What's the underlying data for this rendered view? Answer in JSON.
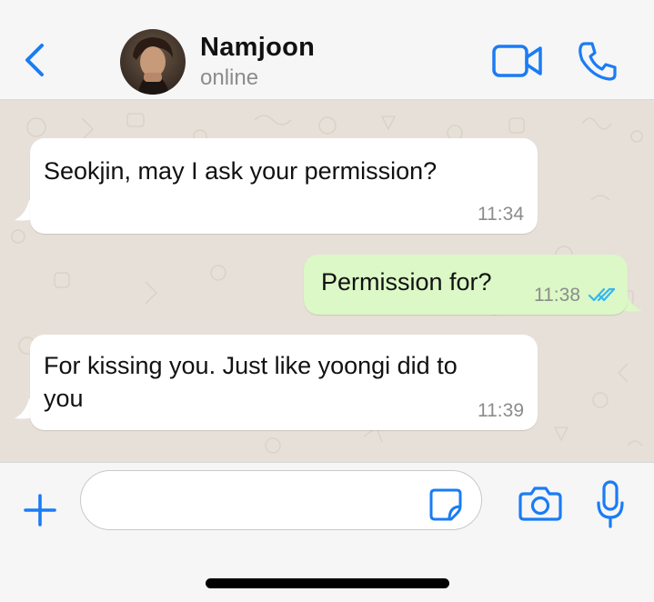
{
  "header": {
    "back_icon": "chevron-left-icon",
    "contact_name": "Namjoon",
    "contact_status": "online",
    "video_icon": "video-camera-icon",
    "call_icon": "phone-icon"
  },
  "messages": [
    {
      "direction": "incoming",
      "text": "Seokjin, may I ask your permission?",
      "time": "11:34"
    },
    {
      "direction": "outgoing",
      "text": "Permission for?",
      "time": "11:38",
      "status": "read"
    },
    {
      "direction": "incoming",
      "text_lines": [
        "For kissing you. Just like yoongi did to",
        "you"
      ],
      "time": "11:39"
    }
  ],
  "input_bar": {
    "plus_icon": "plus-icon",
    "input_value": "",
    "sticker_icon": "sticker-icon",
    "camera_icon": "camera-icon",
    "mic_icon": "microphone-icon"
  },
  "colors": {
    "accent": "#1a7cf5",
    "read_ticks": "#34b7f1",
    "incoming_bubble": "#ffffff",
    "outgoing_bubble": "#dbf8c6",
    "wallpaper": "#e6e0d8"
  }
}
